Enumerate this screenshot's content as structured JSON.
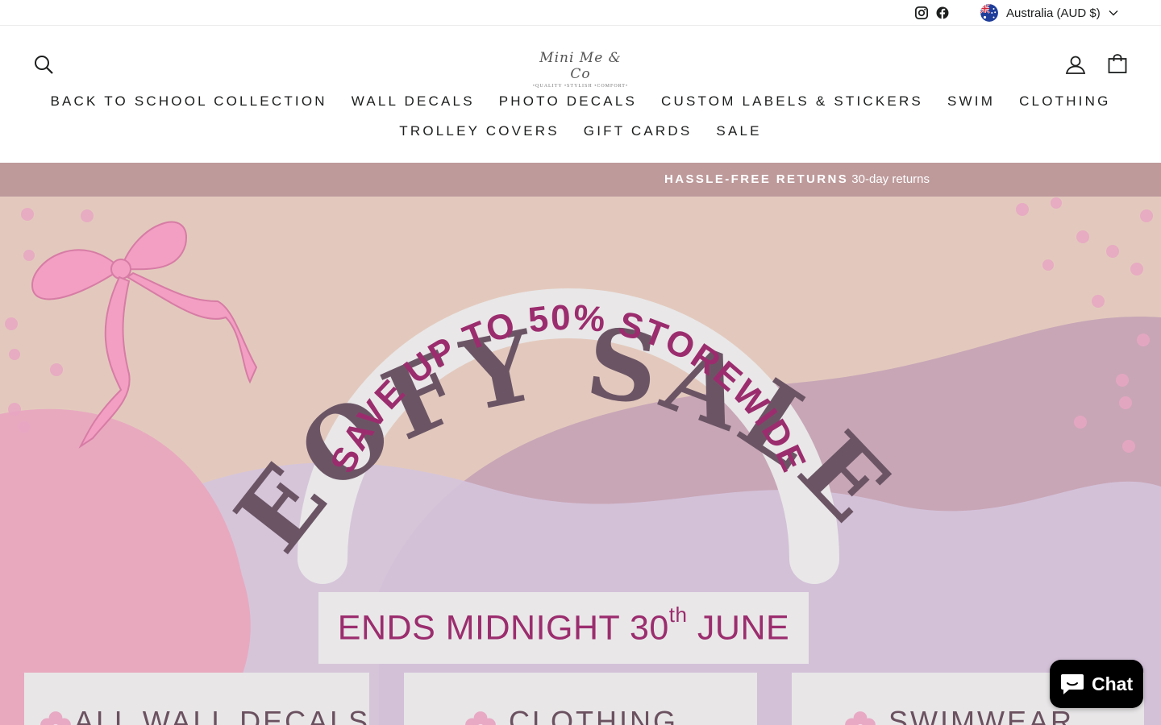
{
  "social": {
    "instagram_icon": "instagram-icon",
    "facebook_icon": "facebook-icon"
  },
  "country_selector": {
    "label": "Australia (AUD $)",
    "flag_icon": "australia-flag-icon"
  },
  "header": {
    "logo_text": "Mini Me & Co",
    "logo_tagline": "•QUALITY •STYLISH •COMFORT•",
    "search_icon": "search-icon",
    "account_icon": "user-icon",
    "cart_icon": "bag-icon"
  },
  "nav": {
    "row1": [
      "BACK TO SCHOOL COLLECTION",
      "WALL DECALS",
      "PHOTO DECALS",
      "CUSTOM LABELS & STICKERS",
      "SWIM",
      "CLOTHING"
    ],
    "row2": [
      "TROLLEY COVERS",
      "GIFT CARDS",
      "SALE"
    ]
  },
  "announcement": {
    "bold": "HASSLE-FREE RETURNS",
    "text": "30-day returns"
  },
  "hero": {
    "headline": "EOFY SALE",
    "arc_text": "SAVE UP TO 50% STOREWIDE",
    "ends_prefix": "ENDS MIDNIGHT 30",
    "ends_sup": "th",
    "ends_suffix": " JUNE",
    "cards": [
      "ALL WALL DECALS",
      "CLOTHING",
      "SWIMWEAR"
    ]
  },
  "chat": {
    "label": "Chat",
    "icon": "chat-bubble-icon"
  },
  "colors": {
    "announcement_bg": "#be9a9b",
    "headline": "#6b5565",
    "accent_magenta": "#9b2d6e",
    "hero_bg": "#e3c9bd"
  }
}
